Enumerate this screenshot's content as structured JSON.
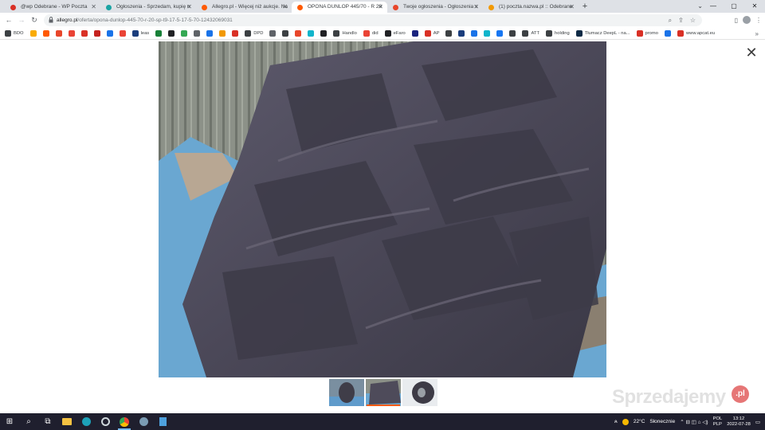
{
  "browser": {
    "tabs": [
      {
        "title": "@wp Odebrane - WP Poczta",
        "fav_color": "#d93025",
        "active": false
      },
      {
        "title": "Ogłoszenia - Sprzedam, kupię n",
        "fav_color": "#1aa3a3",
        "active": false
      },
      {
        "title": "Allegro.pl - Więcej niż aukcje. Na",
        "fav_color": "#ff5a00",
        "active": false
      },
      {
        "title": "OPONA DUNLOP 445/70 - R 20",
        "fav_color": "#ff5a00",
        "active": true
      },
      {
        "title": "Twoje ogłoszenia - Ogłoszenia s",
        "fav_color": "#e8462a",
        "active": false
      },
      {
        "title": "(1) poczta.nazwa.pl :: Odebrane",
        "fav_color": "#f29900",
        "active": false
      }
    ],
    "new_tab": "+",
    "window_controls": {
      "minimize": "—",
      "maximize": "▢",
      "close": "✕"
    },
    "tab_search": "⌄"
  },
  "toolbar": {
    "back": "←",
    "forward": "→",
    "reload": "↻",
    "url_host": "allegro.pl",
    "url_path": "/oferta/opona-dunlop-445-70-r-20-sp-t9-17-5-17-5-70-12432069031",
    "omni_icons": {
      "zoom": "⌕",
      "share": "⇪",
      "star": "☆"
    },
    "right_icons": {
      "sidepanel": "▯",
      "menu": "⋮"
    }
  },
  "bookmarks": [
    {
      "label": "BDO",
      "color": "#3c4043"
    },
    {
      "label": "",
      "color": "#f9ab00"
    },
    {
      "label": "",
      "color": "#ff5a00"
    },
    {
      "label": "",
      "color": "#e8462a"
    },
    {
      "label": "",
      "color": "#ea4335"
    },
    {
      "label": "",
      "color": "#d93025"
    },
    {
      "label": "",
      "color": "#c5221f"
    },
    {
      "label": "",
      "color": "#1a73e8"
    },
    {
      "label": "",
      "color": "#ea4335"
    },
    {
      "label": "leas",
      "color": "#1a3d7c"
    },
    {
      "label": "",
      "color": "#188038"
    },
    {
      "label": "",
      "color": "#202124"
    },
    {
      "label": "",
      "color": "#34a853"
    },
    {
      "label": "",
      "color": "#5f6368"
    },
    {
      "label": "",
      "color": "#1a73e8"
    },
    {
      "label": "",
      "color": "#f29900"
    },
    {
      "label": "",
      "color": "#d93025"
    },
    {
      "label": "DPD",
      "color": "#3c4043"
    },
    {
      "label": "",
      "color": "#5f6368"
    },
    {
      "label": "",
      "color": "#3c4043"
    },
    {
      "label": "",
      "color": "#e8462a"
    },
    {
      "label": "",
      "color": "#12b5cb"
    },
    {
      "label": "",
      "color": "#202124"
    },
    {
      "label": "Handlo",
      "color": "#3c4043"
    },
    {
      "label": "did",
      "color": "#ea4335"
    },
    {
      "label": "eFaro",
      "color": "#202124"
    },
    {
      "label": "",
      "color": "#1a237e"
    },
    {
      "label": "AP",
      "color": "#d93025"
    },
    {
      "label": "",
      "color": "#3c4043"
    },
    {
      "label": "",
      "color": "#1a3d7c"
    },
    {
      "label": "",
      "color": "#1a73e8"
    },
    {
      "label": "",
      "color": "#12b5cb"
    },
    {
      "label": "",
      "color": "#1877f2"
    },
    {
      "label": "",
      "color": "#3c4043"
    },
    {
      "label": "ATT",
      "color": "#3c4043"
    },
    {
      "label": "holding",
      "color": "#3c4043"
    },
    {
      "label": "Tłumacz DeepL - na...",
      "color": "#0f2b46"
    },
    {
      "label": "promo",
      "color": "#d93025"
    },
    {
      "label": "",
      "color": "#1a73e8"
    },
    {
      "label": "www.apcat.eu",
      "color": "#d93025"
    }
  ],
  "bookmarks_more": "»",
  "viewer": {
    "close": "✕",
    "selected_thumb": 1,
    "thumb_count": 3
  },
  "watermark": {
    "text": "Sprzedajemy",
    "badge": ".pl"
  },
  "taskbar": {
    "start": "⊞",
    "search": "⌕",
    "taskview": "⧉",
    "weather_temp": "22°C",
    "weather_text": "Słonecznie",
    "tray_icons": "⌃ ⊟ ◫ ⌂ ◁)",
    "lang_top": "POL",
    "lang_bottom": "PLP",
    "time": "13:12",
    "date": "2022-07-28",
    "notif": "▭"
  }
}
